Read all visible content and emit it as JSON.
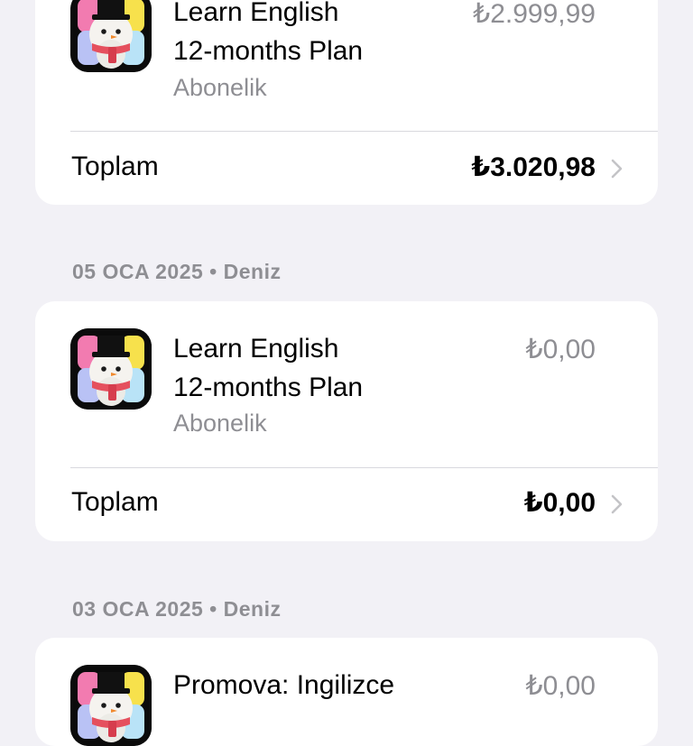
{
  "colors": {
    "background": "#f2f1f6",
    "card": "#ffffff",
    "secondary_text": "#8e8e93",
    "chevron": "#c4c4c7"
  },
  "purchases": [
    {
      "header": "",
      "item": {
        "title_line1": "Learn English",
        "title_line2": "12-months Plan",
        "subtitle": "Abonelik",
        "price": "₺2.999,99",
        "icon": "snowman-app-icon"
      },
      "total_label": "Toplam",
      "total_amount": "₺3.020,98"
    },
    {
      "header": "05 OCA 2025 • Deniz",
      "item": {
        "title_line1": "Learn English",
        "title_line2": "12-months Plan",
        "subtitle": "Abonelik",
        "price": "₺0,00",
        "icon": "snowman-app-icon"
      },
      "total_label": "Toplam",
      "total_amount": "₺0,00"
    },
    {
      "header": "03 OCA 2025 • Deniz",
      "item": {
        "title_line1": "Promova: Ingilizce",
        "price": "₺0,00",
        "icon": "snowman-app-icon"
      }
    }
  ]
}
